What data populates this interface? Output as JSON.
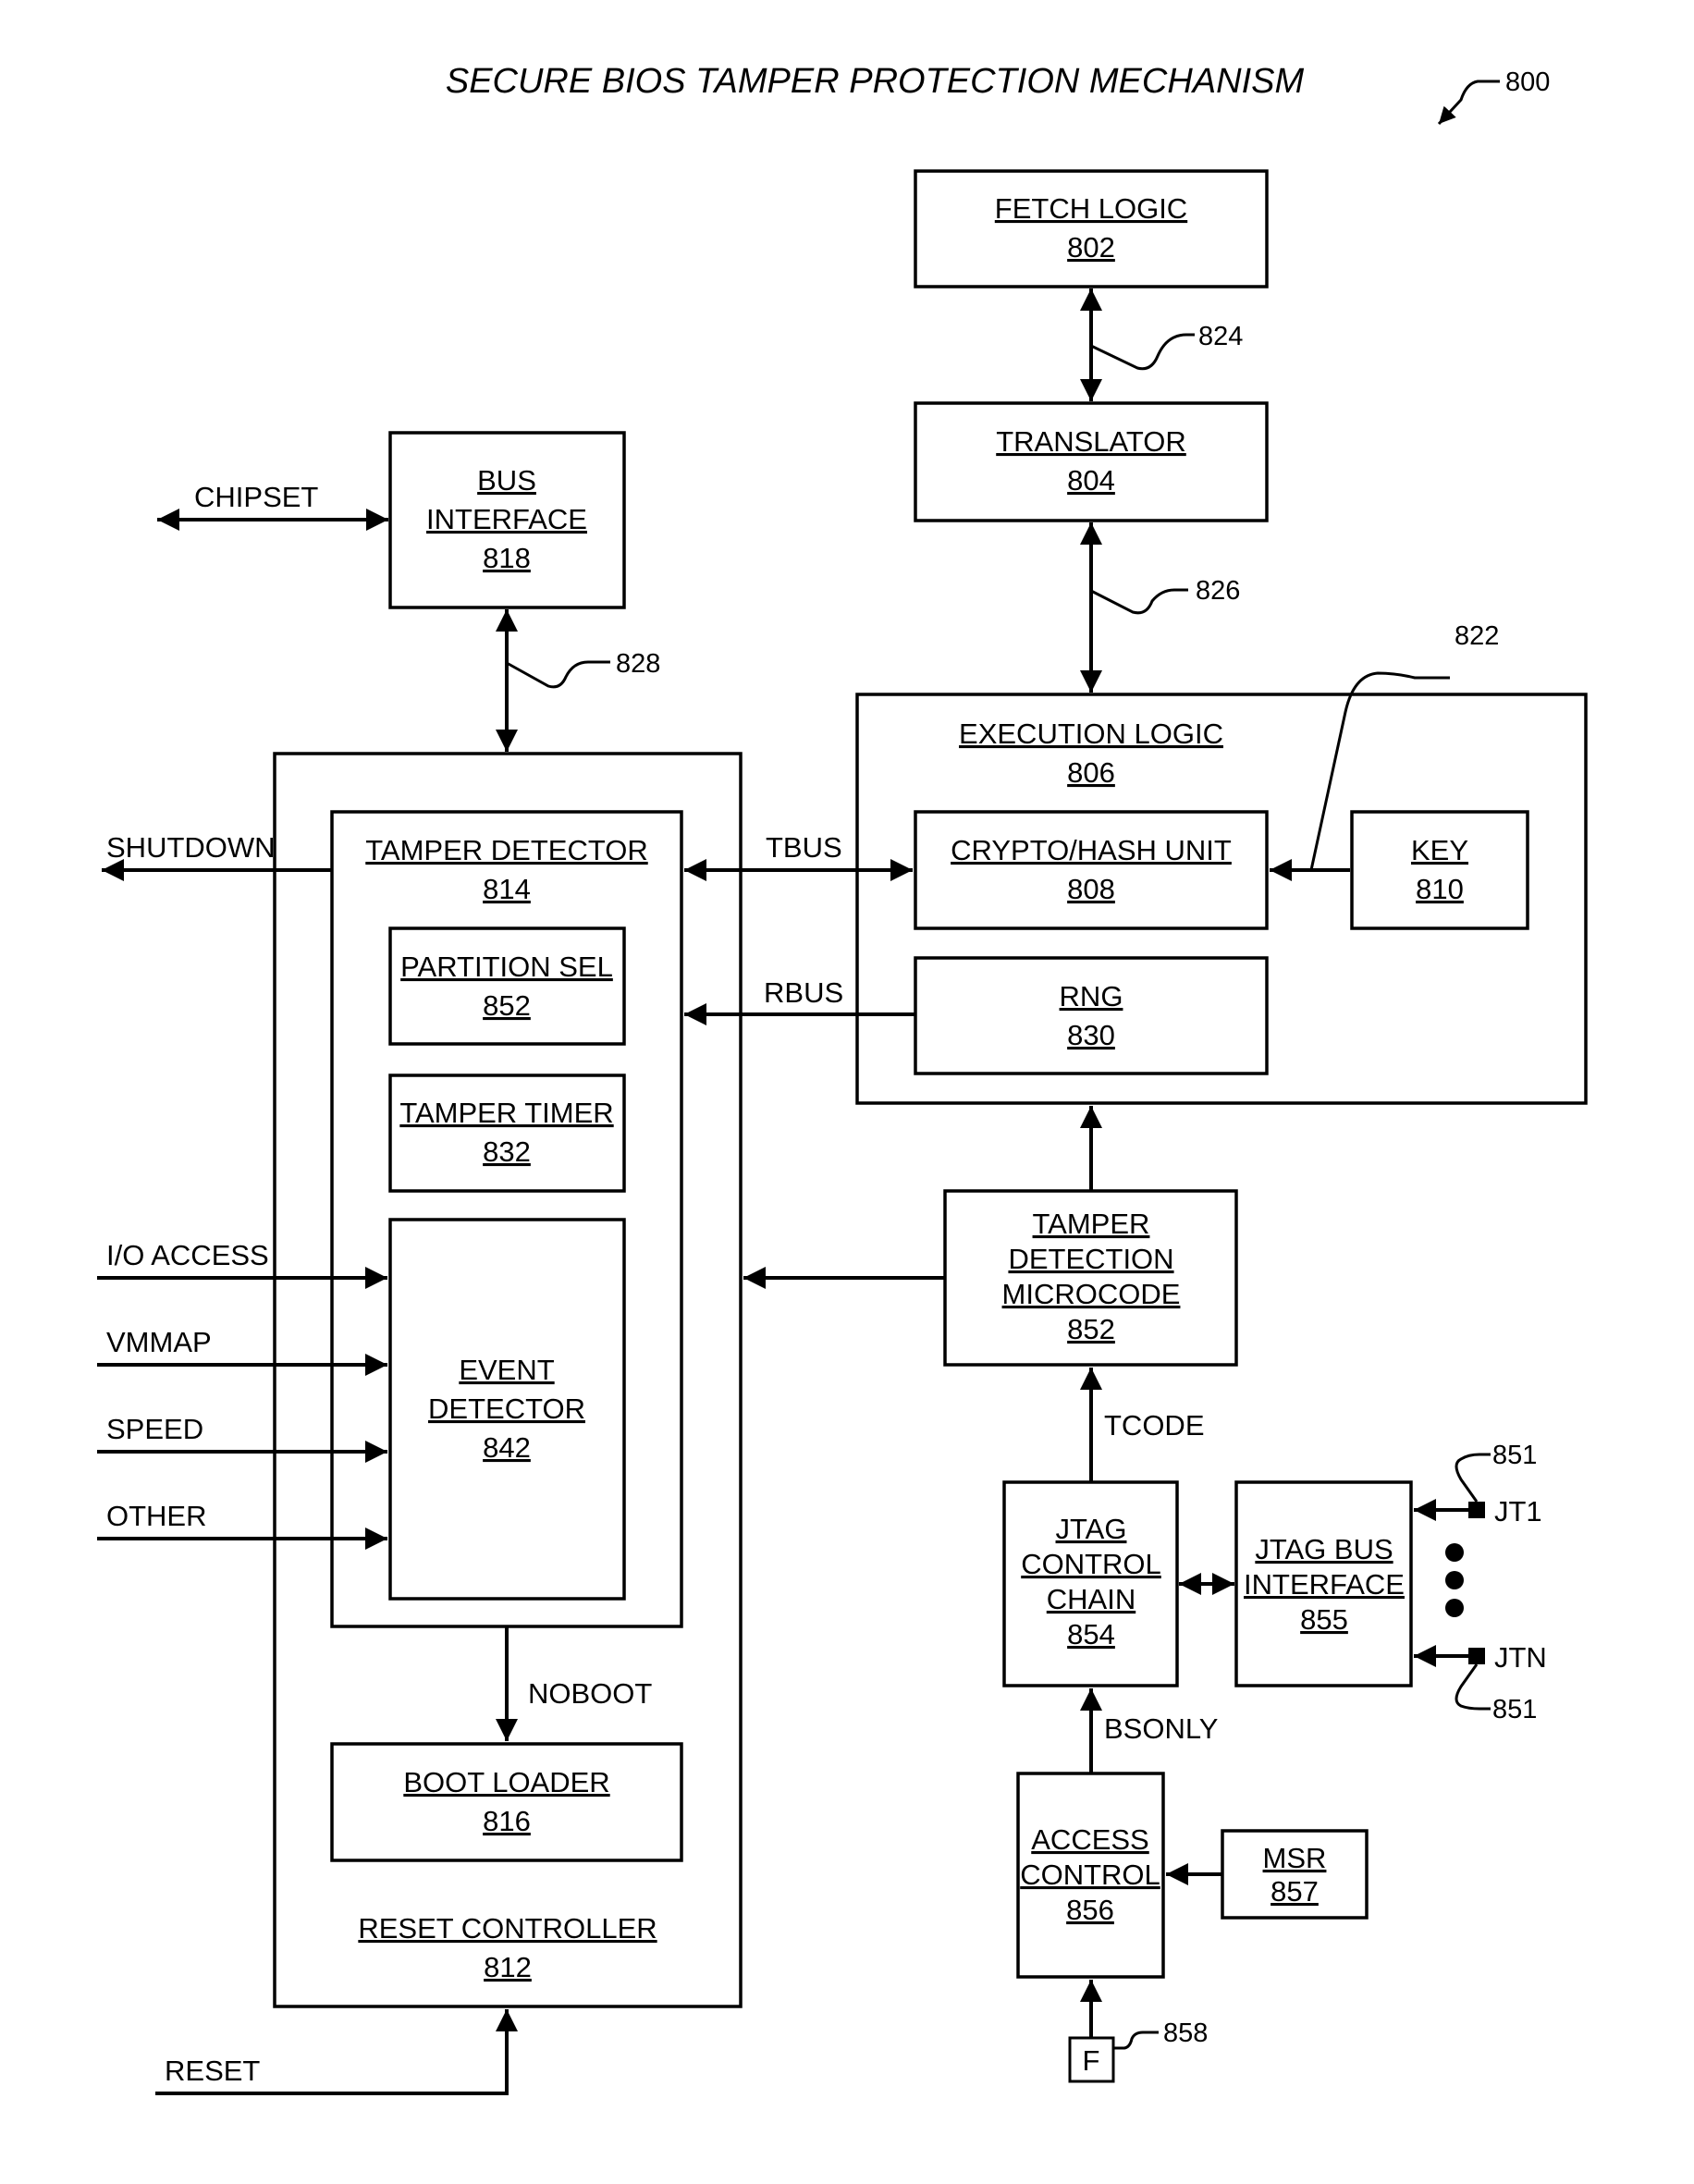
{
  "title": "SECURE BIOS TAMPER PROTECTION MECHANISM",
  "figure_ref": "800",
  "blocks": {
    "fetch_logic": {
      "lines": [
        "FETCH LOGIC"
      ],
      "ref": "802"
    },
    "translator": {
      "lines": [
        "TRANSLATOR"
      ],
      "ref": "804"
    },
    "execution_logic": {
      "lines": [
        "EXECUTION LOGIC"
      ],
      "ref": "806"
    },
    "crypto_hash_unit": {
      "lines": [
        "CRYPTO/HASH UNIT"
      ],
      "ref": "808"
    },
    "key": {
      "lines": [
        "KEY"
      ],
      "ref": "810"
    },
    "rng": {
      "lines": [
        "RNG"
      ],
      "ref": "830"
    },
    "bus_interface": {
      "lines": [
        "BUS",
        "INTERFACE"
      ],
      "ref": "818"
    },
    "reset_controller": {
      "lines": [
        "RESET CONTROLLER"
      ],
      "ref": "812"
    },
    "tamper_detector": {
      "lines": [
        "TAMPER DETECTOR"
      ],
      "ref": "814"
    },
    "partition_sel": {
      "lines": [
        "PARTITION SEL"
      ],
      "ref": "852"
    },
    "tamper_timer": {
      "lines": [
        "TAMPER TIMER"
      ],
      "ref": "832"
    },
    "event_detector": {
      "lines": [
        "EVENT",
        "DETECTOR"
      ],
      "ref": "842"
    },
    "boot_loader": {
      "lines": [
        "BOOT LOADER"
      ],
      "ref": "816"
    },
    "tamper_detection_microcode": {
      "lines": [
        "TAMPER",
        "DETECTION",
        "MICROCODE"
      ],
      "ref": "852"
    },
    "jtag_control_chain": {
      "lines": [
        "JTAG",
        "CONTROL",
        "CHAIN"
      ],
      "ref": "854"
    },
    "jtag_bus_interface": {
      "lines": [
        "JTAG BUS",
        "INTERFACE"
      ],
      "ref": "855"
    },
    "access_control": {
      "lines": [
        "ACCESS",
        "CONTROL"
      ],
      "ref": "856"
    },
    "msr": {
      "lines": [
        "MSR"
      ],
      "ref": "857"
    },
    "fuse": {
      "label": "F"
    }
  },
  "signals": {
    "chipset": "CHIPSET",
    "shutdown": "SHUTDOWN",
    "tbus": "TBUS",
    "rbus": "RBUS",
    "io_access": "I/O ACCESS",
    "vmmap": "VMMAP",
    "speed": "SPEED",
    "other": "OTHER",
    "noboot": "NOBOOT",
    "reset": "RESET",
    "tcode": "TCODE",
    "bsonly": "BSONLY",
    "jt1": "JT1",
    "jtn": "JTN"
  },
  "leader_refs": {
    "bus_824": "824",
    "bus_826": "826",
    "bus_828": "828",
    "key_path_822": "822",
    "jtag_pin_851_top": "851",
    "jtag_pin_851_bottom": "851",
    "fuse_858": "858"
  }
}
